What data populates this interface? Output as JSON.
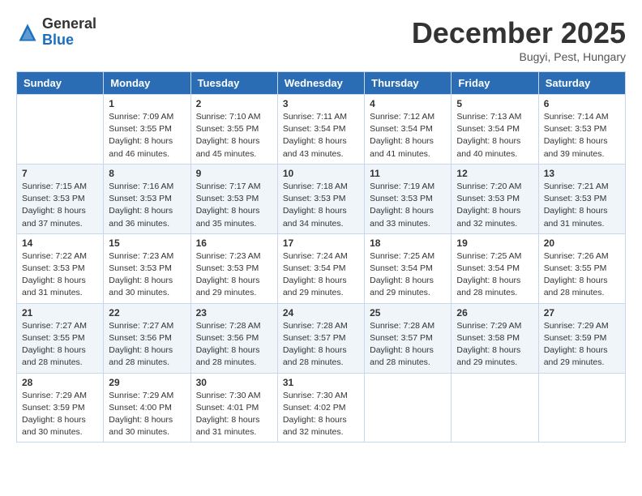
{
  "header": {
    "logo_general": "General",
    "logo_blue": "Blue",
    "month_title": "December 2025",
    "location": "Bugyi, Pest, Hungary"
  },
  "weekdays": [
    "Sunday",
    "Monday",
    "Tuesday",
    "Wednesday",
    "Thursday",
    "Friday",
    "Saturday"
  ],
  "weeks": [
    [
      {
        "day": "",
        "info": ""
      },
      {
        "day": "1",
        "info": "Sunrise: 7:09 AM\nSunset: 3:55 PM\nDaylight: 8 hours\nand 46 minutes."
      },
      {
        "day": "2",
        "info": "Sunrise: 7:10 AM\nSunset: 3:55 PM\nDaylight: 8 hours\nand 45 minutes."
      },
      {
        "day": "3",
        "info": "Sunrise: 7:11 AM\nSunset: 3:54 PM\nDaylight: 8 hours\nand 43 minutes."
      },
      {
        "day": "4",
        "info": "Sunrise: 7:12 AM\nSunset: 3:54 PM\nDaylight: 8 hours\nand 41 minutes."
      },
      {
        "day": "5",
        "info": "Sunrise: 7:13 AM\nSunset: 3:54 PM\nDaylight: 8 hours\nand 40 minutes."
      },
      {
        "day": "6",
        "info": "Sunrise: 7:14 AM\nSunset: 3:53 PM\nDaylight: 8 hours\nand 39 minutes."
      }
    ],
    [
      {
        "day": "7",
        "info": "Sunrise: 7:15 AM\nSunset: 3:53 PM\nDaylight: 8 hours\nand 37 minutes."
      },
      {
        "day": "8",
        "info": "Sunrise: 7:16 AM\nSunset: 3:53 PM\nDaylight: 8 hours\nand 36 minutes."
      },
      {
        "day": "9",
        "info": "Sunrise: 7:17 AM\nSunset: 3:53 PM\nDaylight: 8 hours\nand 35 minutes."
      },
      {
        "day": "10",
        "info": "Sunrise: 7:18 AM\nSunset: 3:53 PM\nDaylight: 8 hours\nand 34 minutes."
      },
      {
        "day": "11",
        "info": "Sunrise: 7:19 AM\nSunset: 3:53 PM\nDaylight: 8 hours\nand 33 minutes."
      },
      {
        "day": "12",
        "info": "Sunrise: 7:20 AM\nSunset: 3:53 PM\nDaylight: 8 hours\nand 32 minutes."
      },
      {
        "day": "13",
        "info": "Sunrise: 7:21 AM\nSunset: 3:53 PM\nDaylight: 8 hours\nand 31 minutes."
      }
    ],
    [
      {
        "day": "14",
        "info": "Sunrise: 7:22 AM\nSunset: 3:53 PM\nDaylight: 8 hours\nand 31 minutes."
      },
      {
        "day": "15",
        "info": "Sunrise: 7:23 AM\nSunset: 3:53 PM\nDaylight: 8 hours\nand 30 minutes."
      },
      {
        "day": "16",
        "info": "Sunrise: 7:23 AM\nSunset: 3:53 PM\nDaylight: 8 hours\nand 29 minutes."
      },
      {
        "day": "17",
        "info": "Sunrise: 7:24 AM\nSunset: 3:54 PM\nDaylight: 8 hours\nand 29 minutes."
      },
      {
        "day": "18",
        "info": "Sunrise: 7:25 AM\nSunset: 3:54 PM\nDaylight: 8 hours\nand 29 minutes."
      },
      {
        "day": "19",
        "info": "Sunrise: 7:25 AM\nSunset: 3:54 PM\nDaylight: 8 hours\nand 28 minutes."
      },
      {
        "day": "20",
        "info": "Sunrise: 7:26 AM\nSunset: 3:55 PM\nDaylight: 8 hours\nand 28 minutes."
      }
    ],
    [
      {
        "day": "21",
        "info": "Sunrise: 7:27 AM\nSunset: 3:55 PM\nDaylight: 8 hours\nand 28 minutes."
      },
      {
        "day": "22",
        "info": "Sunrise: 7:27 AM\nSunset: 3:56 PM\nDaylight: 8 hours\nand 28 minutes."
      },
      {
        "day": "23",
        "info": "Sunrise: 7:28 AM\nSunset: 3:56 PM\nDaylight: 8 hours\nand 28 minutes."
      },
      {
        "day": "24",
        "info": "Sunrise: 7:28 AM\nSunset: 3:57 PM\nDaylight: 8 hours\nand 28 minutes."
      },
      {
        "day": "25",
        "info": "Sunrise: 7:28 AM\nSunset: 3:57 PM\nDaylight: 8 hours\nand 28 minutes."
      },
      {
        "day": "26",
        "info": "Sunrise: 7:29 AM\nSunset: 3:58 PM\nDaylight: 8 hours\nand 29 minutes."
      },
      {
        "day": "27",
        "info": "Sunrise: 7:29 AM\nSunset: 3:59 PM\nDaylight: 8 hours\nand 29 minutes."
      }
    ],
    [
      {
        "day": "28",
        "info": "Sunrise: 7:29 AM\nSunset: 3:59 PM\nDaylight: 8 hours\nand 30 minutes."
      },
      {
        "day": "29",
        "info": "Sunrise: 7:29 AM\nSunset: 4:00 PM\nDaylight: 8 hours\nand 30 minutes."
      },
      {
        "day": "30",
        "info": "Sunrise: 7:30 AM\nSunset: 4:01 PM\nDaylight: 8 hours\nand 31 minutes."
      },
      {
        "day": "31",
        "info": "Sunrise: 7:30 AM\nSunset: 4:02 PM\nDaylight: 8 hours\nand 32 minutes."
      },
      {
        "day": "",
        "info": ""
      },
      {
        "day": "",
        "info": ""
      },
      {
        "day": "",
        "info": ""
      }
    ]
  ]
}
